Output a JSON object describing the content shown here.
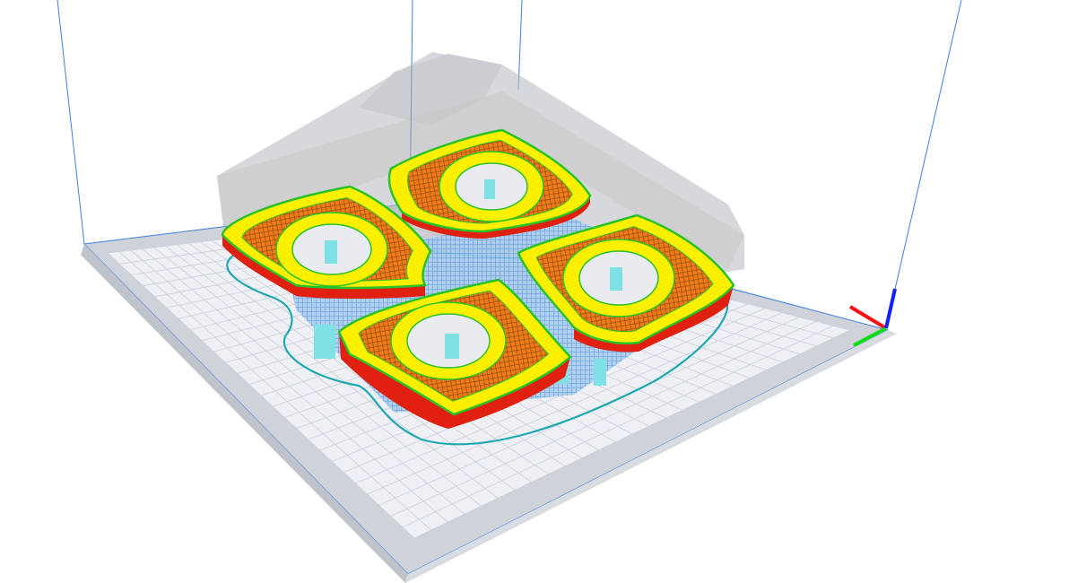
{
  "viewport": {
    "mode": "layer-preview",
    "background": "#ffffff"
  },
  "colors": {
    "bed_grid_line": "#c9d0dd",
    "bed_surface": "#eef0f4",
    "bed_frame": "#cdd0d6",
    "build_volume_line": "#3d7fe0",
    "skirt": "#1fa8b0",
    "outer_wall": "#e02010",
    "perimeter": "#fff200",
    "inner_wall": "#27c227",
    "infill": "#f07a16",
    "infill_lines": "#8a4a1a",
    "support": "#7fb5e8",
    "support_interface": "#7fe0e6",
    "overhang_shadow": "#c8c8cc"
  },
  "axes": {
    "x_color": "#ff1010",
    "y_color": "#10dd10",
    "z_color": "#1020ff"
  },
  "parts": [
    {
      "name": "ring-part-top"
    },
    {
      "name": "ring-part-left"
    },
    {
      "name": "ring-part-right"
    },
    {
      "name": "ring-part-bottom"
    }
  ]
}
